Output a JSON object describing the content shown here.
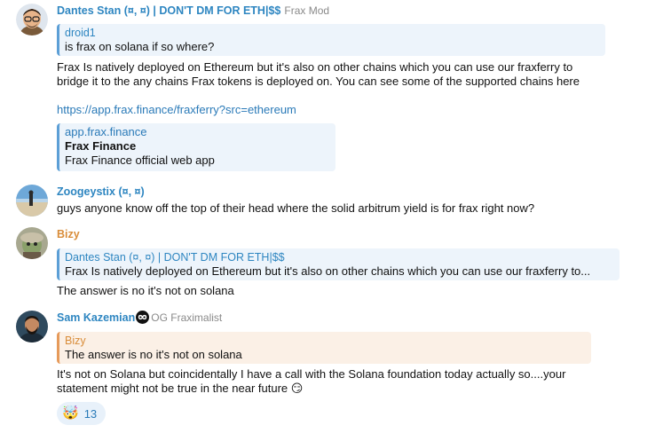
{
  "colors": {
    "dantes_name": "#2e86c1",
    "zoogey_name": "#2e86c1",
    "bizy_name": "#d98d3a",
    "sam_name": "#2e86c1",
    "droid_name": "#2e86c1",
    "link": "#2a7ab8"
  },
  "messages": [
    {
      "sender": "Dantes Stan (¤, ¤) | DON'T DM FOR ETH|$$",
      "role": "Frax Mod",
      "reply_to": {
        "name": "droid1",
        "text": "is frax on solana if so where?"
      },
      "text": "Frax Is natively deployed on Ethereum but it's also on other chains which you can use our fraxferry to\nbridge it to the any chains Frax tokens is deployed on. You can see some of the supported chains here",
      "link": "https://app.frax.finance/fraxferry?src=ethereum",
      "preview": {
        "site": "app.frax.finance",
        "title": "Frax Finance",
        "description": "Frax Finance official web app"
      }
    },
    {
      "sender": "Zoogeystix (¤, ¤)",
      "text": "guys anyone know off the top of their head where the solid arbitrum yield is for frax right now?"
    },
    {
      "sender": "Bizy",
      "reply_to": {
        "name": "Dantes Stan (¤, ¤) | DON'T DM FOR ETH|$$",
        "text": "Frax Is natively deployed on Ethereum but it's also on other chains which you can use our fraxferry to..."
      },
      "text": "The answer is no it's not on solana"
    },
    {
      "sender": "Sam Kazemian",
      "role": "OG Fraximalist",
      "reply_to": {
        "name": "Bizy",
        "text": "The answer is no it's not on solana"
      },
      "text": "It's not on Solana but coincidentally I have a call with the Solana foundation today actually so....your\nstatement might not be true in the near future",
      "text_emoji": "😏",
      "reaction": {
        "emoji": "🤯",
        "count": "13"
      }
    }
  ]
}
